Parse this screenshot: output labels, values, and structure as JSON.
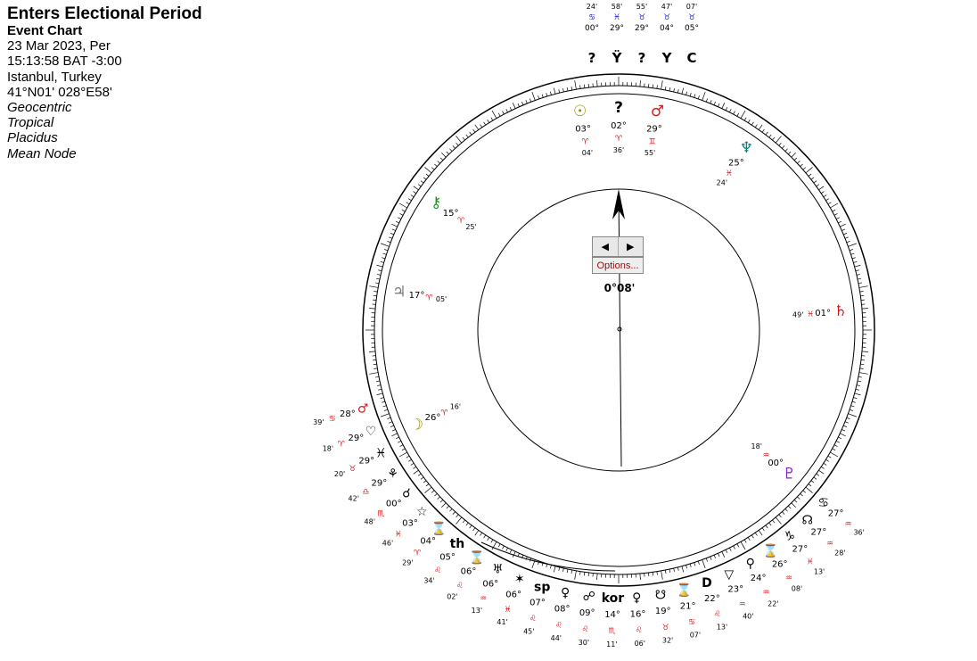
{
  "header": {
    "title": "Enters Electional Period",
    "subtitle": "Event Chart",
    "date": "23 Mar 2023, Per",
    "time": "15:13:58  BAT -3:00",
    "place": "Istanbul, Turkey",
    "coords": "41°N01' 028°E58'",
    "settings": [
      "Geocentric",
      "Tropical",
      "Placidus",
      "Mean Node"
    ]
  },
  "controls": {
    "prev_label": "◀",
    "next_label": "▶",
    "options_label": "Options...",
    "dial_readout": "0°08'"
  },
  "colors": {
    "red": "#e01818",
    "green": "#18a018",
    "blue": "#1818d8",
    "cyan": "#10b0c0",
    "purple": "#8020c8",
    "olive": "#9a8a00",
    "teal": "#008080",
    "black": "#000000"
  },
  "outer_ring": [
    {
      "glyph": "♂",
      "deg": "28°",
      "min": "39'",
      "sign": "♋",
      "retro": "℞",
      "color": "red"
    },
    {
      "glyph": "♡",
      "deg": "29°",
      "min": "18'",
      "sign": "♈",
      "retro": "℞",
      "color": "black"
    },
    {
      "glyph": "♓",
      "deg": "29°",
      "min": "20'",
      "sign": "♉",
      "retro": "℞",
      "color": "black"
    },
    {
      "glyph": "⚘",
      "deg": "29°",
      "min": "42'",
      "sign": "♎",
      "retro": "℞",
      "color": "black"
    },
    {
      "glyph": "☌",
      "deg": "00°",
      "min": "48'",
      "sign": "♏",
      "retro": "℞",
      "color": "black"
    },
    {
      "glyph": "☆",
      "deg": "03°",
      "min": "46'",
      "sign": "♓",
      "retro": "℞",
      "color": "black"
    },
    {
      "glyph": "⌛",
      "deg": "04°",
      "min": "29'",
      "sign": "♈",
      "retro": "",
      "color": "black"
    },
    {
      "glyph": "th",
      "deg": "05°",
      "min": "34'",
      "sign": "♌",
      "retro": "",
      "color": "black"
    },
    {
      "glyph": "⌛",
      "deg": "06°",
      "min": "02'",
      "sign": "♌",
      "retro": "",
      "color": "black"
    },
    {
      "glyph": "♅",
      "deg": "06°",
      "min": "13'",
      "sign": "♒",
      "retro": "℞",
      "color": "black"
    },
    {
      "glyph": "✶",
      "deg": "06°",
      "min": "41'",
      "sign": "♓",
      "retro": "℞",
      "color": "black"
    },
    {
      "glyph": "sp",
      "deg": "07°",
      "min": "45'",
      "sign": "♌",
      "retro": "",
      "color": "black"
    },
    {
      "glyph": "♀",
      "deg": "08°",
      "min": "44'",
      "sign": "♌",
      "retro": "℞",
      "color": "black"
    },
    {
      "glyph": "☍",
      "deg": "09°",
      "min": "30'",
      "sign": "♌",
      "retro": "℞",
      "color": "black"
    },
    {
      "glyph": "kor",
      "deg": "14°",
      "min": "11'",
      "sign": "♏",
      "retro": "",
      "color": "black"
    },
    {
      "glyph": "♀",
      "deg": "16°",
      "min": "06'",
      "sign": "♌",
      "retro": "℞",
      "color": "black"
    },
    {
      "glyph": "☋",
      "deg": "19°",
      "min": "32'",
      "sign": "♉",
      "retro": "℞",
      "color": "black"
    },
    {
      "glyph": "⌛",
      "deg": "21°",
      "min": "07'",
      "sign": "♋",
      "retro": "℞",
      "color": "black"
    },
    {
      "glyph": "D",
      "deg": "22°",
      "min": "13'",
      "sign": "♌",
      "retro": "",
      "color": "black"
    },
    {
      "glyph": "▽",
      "deg": "23°",
      "min": "40'",
      "sign": "♒",
      "retro": "",
      "color": "black"
    },
    {
      "glyph": "⚲",
      "deg": "24°",
      "min": "22'",
      "sign": "♒",
      "retro": "",
      "color": "black"
    },
    {
      "glyph": "⌛",
      "deg": "26°",
      "min": "08'",
      "sign": "♒",
      "retro": "",
      "color": "black"
    },
    {
      "glyph": "♑",
      "deg": "27°",
      "min": "13'",
      "sign": "♓",
      "retro": "",
      "color": "black"
    },
    {
      "glyph": "☊",
      "deg": "27°",
      "min": "28'",
      "sign": "♒",
      "retro": "",
      "color": "black"
    },
    {
      "glyph": "♋",
      "deg": "27°",
      "min": "36'",
      "sign": "♒",
      "retro": "",
      "color": "black"
    }
  ],
  "top_labels": [
    {
      "glyph": "?",
      "deg": "00°",
      "min": "24'",
      "sign": "♋"
    },
    {
      "glyph": "Ÿ",
      "deg": "29°",
      "min": "58'",
      "sign": "♓"
    },
    {
      "glyph": "?",
      "deg": "29°",
      "min": "55'",
      "sign": "♉"
    },
    {
      "glyph": "Y",
      "deg": "04°",
      "min": "47'",
      "sign": "♉"
    },
    {
      "glyph": "C",
      "deg": "05°",
      "min": "07'",
      "sign": "♉"
    }
  ],
  "inner_planets": [
    {
      "glyph": "☉",
      "deg": "03°",
      "min": "04'",
      "sign": "♈",
      "color": "olive"
    },
    {
      "glyph": "?",
      "deg": "02°",
      "min": "36'",
      "sign": "♈",
      "color": "black"
    },
    {
      "glyph": "♂",
      "deg": "29°",
      "min": "55'",
      "sign": "♊",
      "color": "red"
    },
    {
      "glyph": "♆",
      "deg": "25°",
      "min": "24'",
      "sign": "♓",
      "color": "teal"
    },
    {
      "glyph": "♄",
      "deg": "01°",
      "min": "49'",
      "sign": "♓",
      "color": "red"
    },
    {
      "glyph": "♇",
      "deg": "00°",
      "min": "18'",
      "sign": "♒",
      "color": "purple"
    },
    {
      "glyph": "☽",
      "deg": "26°",
      "min": "16'",
      "sign": "♈",
      "color": "olive"
    },
    {
      "glyph": "♃",
      "deg": "17°",
      "min": "05'",
      "sign": "♈",
      "color": "gray"
    },
    {
      "glyph": "⚷",
      "deg": "15°",
      "min": "25'",
      "sign": "♈",
      "color": "green"
    }
  ],
  "dial": {
    "pointer_angle": "0°08'"
  }
}
